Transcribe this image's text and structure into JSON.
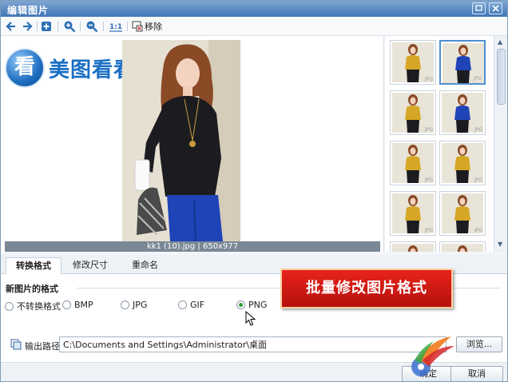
{
  "window": {
    "title": "编辑图片",
    "controls": [
      "restore-icon",
      "close-icon"
    ]
  },
  "toolbar": {
    "items": [
      "back-icon",
      "forward-icon",
      "add-icon",
      "zoom-in-icon",
      "zoom-out-icon",
      "actual-size-icon",
      "remove-icon"
    ],
    "remove_label": "移除"
  },
  "viewer": {
    "logo_glyph": "看",
    "logo_text": "美图看看",
    "caption": "kk1 (10).jpg | 650x977"
  },
  "thumbnails": {
    "selected_index": 1,
    "colors": [
      "#d6a726",
      "#1f44b8",
      "#d6a726",
      "#1f44b8",
      "#d6a726",
      "#d6a726",
      "#d6a726",
      "#d6a726",
      "#d6a726",
      "#d6a726"
    ],
    "watermark": "JPG"
  },
  "tabs": [
    {
      "label": "转换格式",
      "active": true
    },
    {
      "label": "修改尺寸",
      "active": false
    },
    {
      "label": "重命名",
      "active": false
    }
  ],
  "format": {
    "heading": "新图片的格式",
    "options": [
      "不转换格式",
      "BMP",
      "JPG",
      "GIF",
      "PNG"
    ],
    "selected": "PNG"
  },
  "banner": "批量修改图片格式",
  "output": {
    "label": "输出路径",
    "path": "C:\\Documents and Settings\\Administrator\\桌面",
    "browse_label": "浏览..."
  },
  "buttons": {
    "ok_label": "确定",
    "cancel_label": "取消"
  },
  "colors": {
    "title_bar": "#3f75b6",
    "banner": "#d41a14",
    "selected_radio": "#2e9a3a"
  }
}
